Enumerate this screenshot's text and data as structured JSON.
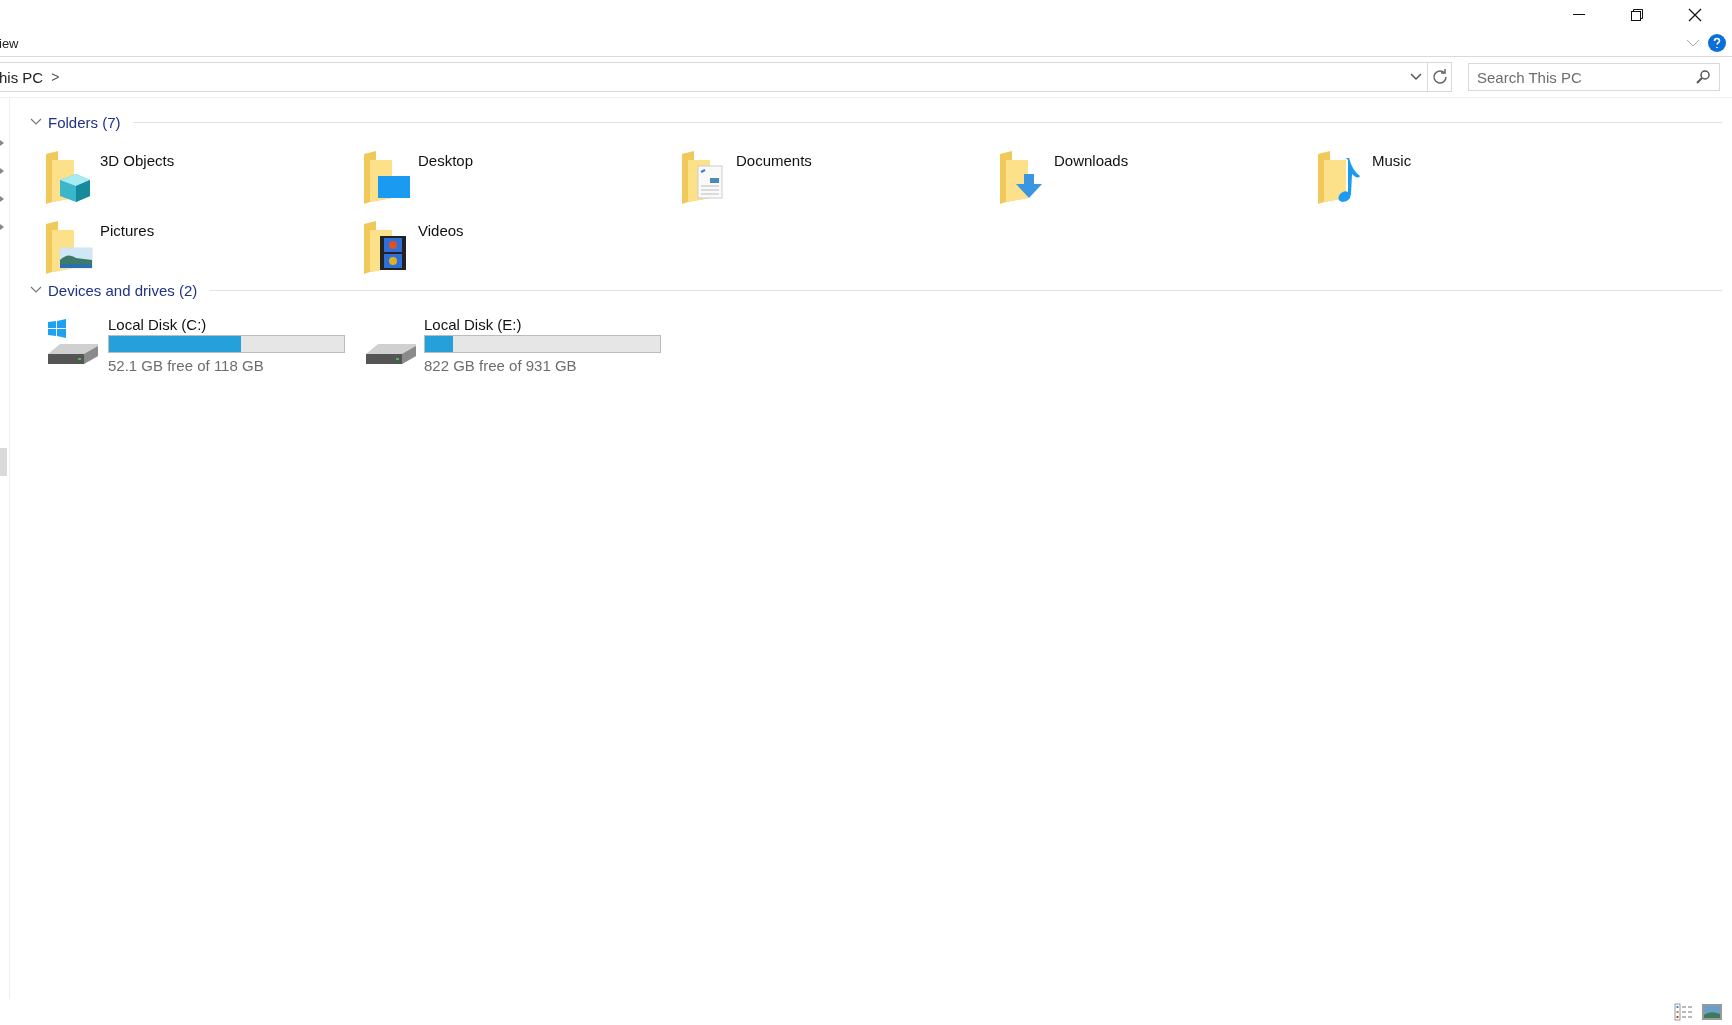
{
  "ribbon": {
    "tab_label": "iew"
  },
  "address_bar": {
    "breadcrumb": "his PC",
    "separator": ">"
  },
  "search": {
    "placeholder": "Search This PC"
  },
  "groups": [
    {
      "kind": "folders",
      "title": "Folders (7)",
      "expanded": true,
      "items": [
        {
          "kind": "objects3d",
          "name": "3D Objects"
        },
        {
          "kind": "desktop",
          "name": "Desktop"
        },
        {
          "kind": "documents",
          "name": "Documents"
        },
        {
          "kind": "downloads",
          "name": "Downloads"
        },
        {
          "kind": "music",
          "name": "Music"
        },
        {
          "kind": "pictures",
          "name": "Pictures"
        },
        {
          "kind": "videos",
          "name": "Videos"
        }
      ]
    },
    {
      "kind": "drives",
      "title": "Devices and drives (2)",
      "expanded": true,
      "items": [
        {
          "kind": "system",
          "name": "Local Disk (C:)",
          "level": 0.56,
          "reading": "52.1 GB free of 118 GB"
        },
        {
          "kind": "disk",
          "name": "Local Disk (E:)",
          "level": 0.12,
          "reading": "822 GB free of 931 GB"
        }
      ]
    }
  ]
}
